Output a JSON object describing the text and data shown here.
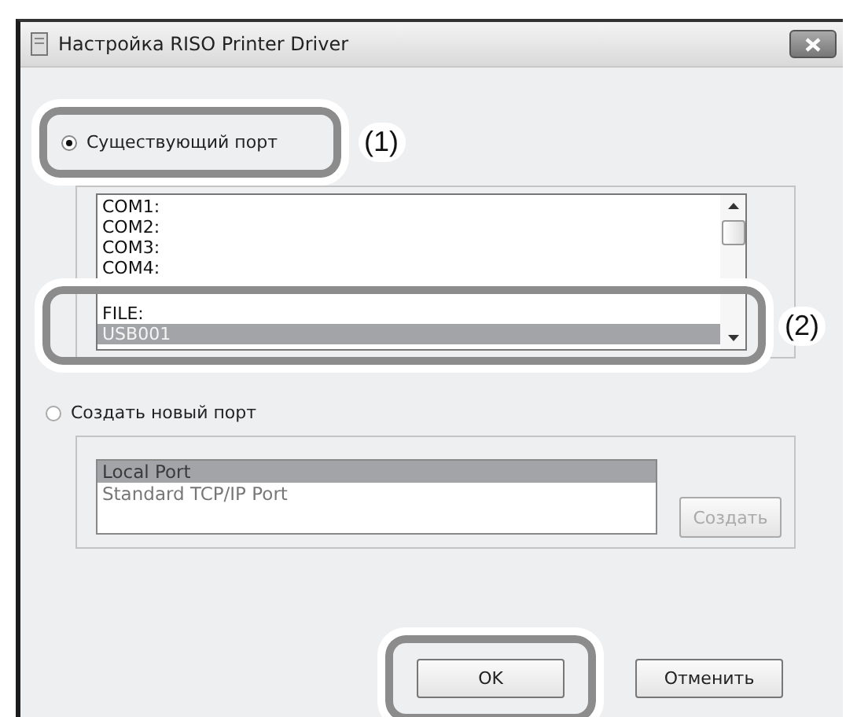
{
  "window": {
    "title": "Настройка RISO Printer Driver"
  },
  "existing_port": {
    "label": "Существующий порт",
    "selected": true,
    "callout": "(1)"
  },
  "port_list": {
    "callout": "(2)",
    "items": [
      {
        "label": "COM1:",
        "selected": false
      },
      {
        "label": "COM2:",
        "selected": false
      },
      {
        "label": "COM3:",
        "selected": false
      },
      {
        "label": "COM4:",
        "selected": false
      },
      {
        "label": "FILE:",
        "selected": false
      },
      {
        "label": "USB001",
        "selected": true
      }
    ]
  },
  "new_port": {
    "label": "Создать новый порт",
    "selected": false,
    "disabled": true,
    "types": [
      {
        "label": "Local Port",
        "selected": true
      },
      {
        "label": "Standard TCP/IP Port",
        "selected": false
      }
    ],
    "create_button": "Создать"
  },
  "buttons": [
    {
      "label": "OK",
      "circled": true
    },
    {
      "label": "Отменить",
      "circled": false
    }
  ]
}
